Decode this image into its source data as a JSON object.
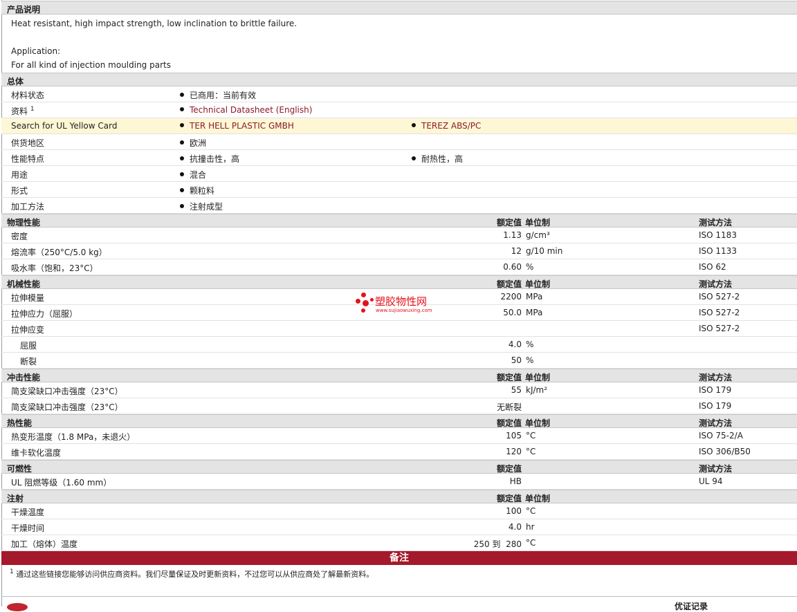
{
  "description": {
    "header": "产品说明",
    "line1": "Heat resistant, high impact strength, low inclination to brittle failure.",
    "app_label": "Application:",
    "app_text": "For all kind of injection moulding parts"
  },
  "general": {
    "header": "总体",
    "material_status_label": "材料状态",
    "material_status_value": "已商用：当前有效",
    "literature_label": "资料",
    "literature_sup": "1",
    "literature_value": "Technical Datasheet (English)",
    "ul_label": "Search for UL Yellow Card",
    "ul_value1": "TER HELL PLASTIC GMBH",
    "ul_value2": "TEREZ ABS/PC",
    "region_label": "供货地区",
    "region_value": "欧洲",
    "features_label": "性能特点",
    "features_value1": "抗撞击性，高",
    "features_value2": "耐热性，高",
    "uses_label": "用途",
    "uses_value": "混合",
    "form_label": "形式",
    "form_value": "颗粒料",
    "process_label": "加工方法",
    "process_value": "注射成型"
  },
  "headers": {
    "value": "额定值",
    "unit": "单位制",
    "method": "测试方法"
  },
  "physical": {
    "title": "物理性能",
    "rows": [
      {
        "label": "密度",
        "value": "1.13",
        "unit": "g/cm³",
        "method": "ISO 1183"
      },
      {
        "label": "熔流率（250°C/5.0 kg）",
        "value": "12",
        "unit": "g/10 min",
        "method": "ISO 1133"
      },
      {
        "label": "吸水率（饱和，23°C）",
        "value": "0.60",
        "unit": "%",
        "method": "ISO 62"
      }
    ]
  },
  "mechanical": {
    "title": "机械性能",
    "rows": [
      {
        "label": "拉伸模量",
        "value": "2200",
        "unit": "MPa",
        "method": "ISO 527-2"
      },
      {
        "label": "拉伸应力（屈服）",
        "value": "50.0",
        "unit": "MPa",
        "method": "ISO 527-2"
      },
      {
        "label": "拉伸应变",
        "value": "",
        "unit": "",
        "method": "ISO 527-2"
      },
      {
        "label": "屈服",
        "value": "4.0",
        "unit": "%",
        "method": ""
      },
      {
        "label": "断裂",
        "value": "50",
        "unit": "%",
        "method": ""
      }
    ]
  },
  "impact": {
    "title": "冲击性能",
    "rows": [
      {
        "label": "简支梁缺口冲击强度（23°C）",
        "value": "55",
        "unit": "kJ/m²",
        "method": "ISO 179"
      },
      {
        "label": "简支梁缺口冲击强度（23°C）",
        "value": "无断裂",
        "unit": "",
        "method": "ISO 179"
      }
    ]
  },
  "thermal": {
    "title": "热性能",
    "rows": [
      {
        "label": "热变形温度（1.8 MPa，未退火）",
        "value": "105",
        "unit": "°C",
        "method": "ISO 75-2/A"
      },
      {
        "label": "维卡软化温度",
        "value": "120",
        "unit": "°C",
        "method": "ISO 306/B50"
      }
    ]
  },
  "flammability": {
    "title": "可燃性",
    "rows": [
      {
        "label": "UL 阻燃等级（1.60 mm）",
        "value": "HB",
        "unit": "",
        "method": "UL 94"
      }
    ]
  },
  "injection": {
    "title": "注射",
    "rows": [
      {
        "label": "干燥温度",
        "value": "100",
        "unit": "°C",
        "method": ""
      },
      {
        "label": "干燥时间",
        "value": "4.0",
        "unit": "hr",
        "method": ""
      },
      {
        "label": "加工（熔体）温度",
        "value": "250 到  280",
        "unit": "°C",
        "method": ""
      }
    ]
  },
  "notes": {
    "title": "备注",
    "sup": "1",
    "text": "通过这些链接您能够访问供应商资料。我们尽量保证及时更新资料，不过您可以从供应商处了解最新资料。"
  },
  "watermark": {
    "text": "塑胶物性网",
    "url": "www.sujiaowuxing.com"
  },
  "footer": {
    "corner_text": "优证记录"
  },
  "colors": {
    "section_bg": "#e4e4e4",
    "link": "#8b1a2a",
    "highlight_row": "#fdf7d6",
    "notes_bar": "#a4192b",
    "watermark": "#e5121c"
  }
}
